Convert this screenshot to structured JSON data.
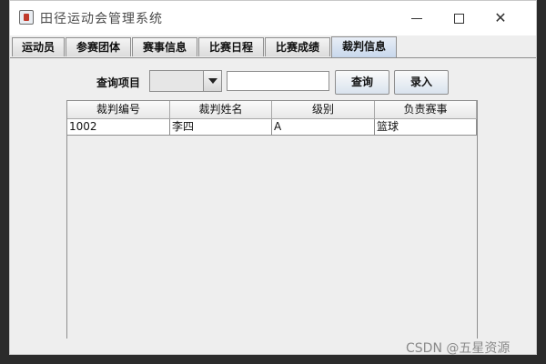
{
  "window": {
    "title": "田径运动会管理系统",
    "minimize_icon": "minimize-icon",
    "maximize_icon": "maximize-icon",
    "close_icon": "close-icon",
    "close_glyph": "✕"
  },
  "tabs": [
    {
      "label": "运动员",
      "active": false
    },
    {
      "label": "参赛团体",
      "active": false
    },
    {
      "label": "赛事信息",
      "active": false
    },
    {
      "label": "比赛日程",
      "active": false
    },
    {
      "label": "比赛成绩",
      "active": false
    },
    {
      "label": "裁判信息",
      "active": true
    }
  ],
  "query": {
    "label": "查询项目",
    "combo_value": "",
    "input_value": "",
    "query_button": "查询",
    "entry_button": "录入"
  },
  "table": {
    "columns": [
      "裁判编号",
      "裁判姓名",
      "级别",
      "负责赛事"
    ],
    "rows": [
      [
        "1002",
        "李四",
        "A",
        "篮球"
      ]
    ]
  },
  "watermark": "CSDN @五星资源"
}
